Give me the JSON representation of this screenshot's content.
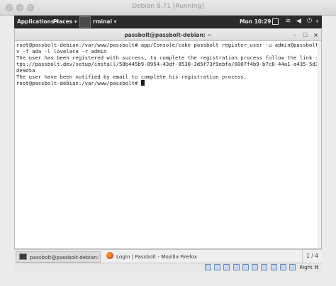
{
  "vm_window": {
    "title": "Debian 8.71 [Running]"
  },
  "gnome_bar": {
    "applications": "Applications ▾",
    "places": "Places ▾",
    "task": "rminal ▾",
    "clock": "Mon 10:29"
  },
  "terminal": {
    "title": "passbolt@passbolt-debian: ~",
    "lines": [
      "root@passbolt-debian:/var/www/passbolt# app/Console/cake passbolt register_user -u admin@passbolt.de",
      "v -f ada -l lovelace -r admin",
      "The user has been registered with success, to complete the registration process follow the link : ht",
      "tps://passbolt.dev/setup/install/58b445b9-8954-43df-8530-3d5f73f9ebfa/6007f4b9-b7c8-44a1-a435-5d309b",
      "de9d5a",
      "The user have been notified by email to complete his registration process.",
      "root@passbolt-debian:/var/www/passbolt# "
    ]
  },
  "bottom_panel": {
    "tasks": [
      {
        "label": "passbolt@passbolt-debian:"
      },
      {
        "label": "Login | Passbolt - Mozilla Firefox"
      }
    ],
    "pager": "1 / 4"
  },
  "vbox_status": {
    "host_key": "Right ⌘"
  },
  "colors": {
    "panel": "#2b2b2b",
    "terminal_bg": "#ffffff",
    "terminal_fg": "#222222"
  }
}
